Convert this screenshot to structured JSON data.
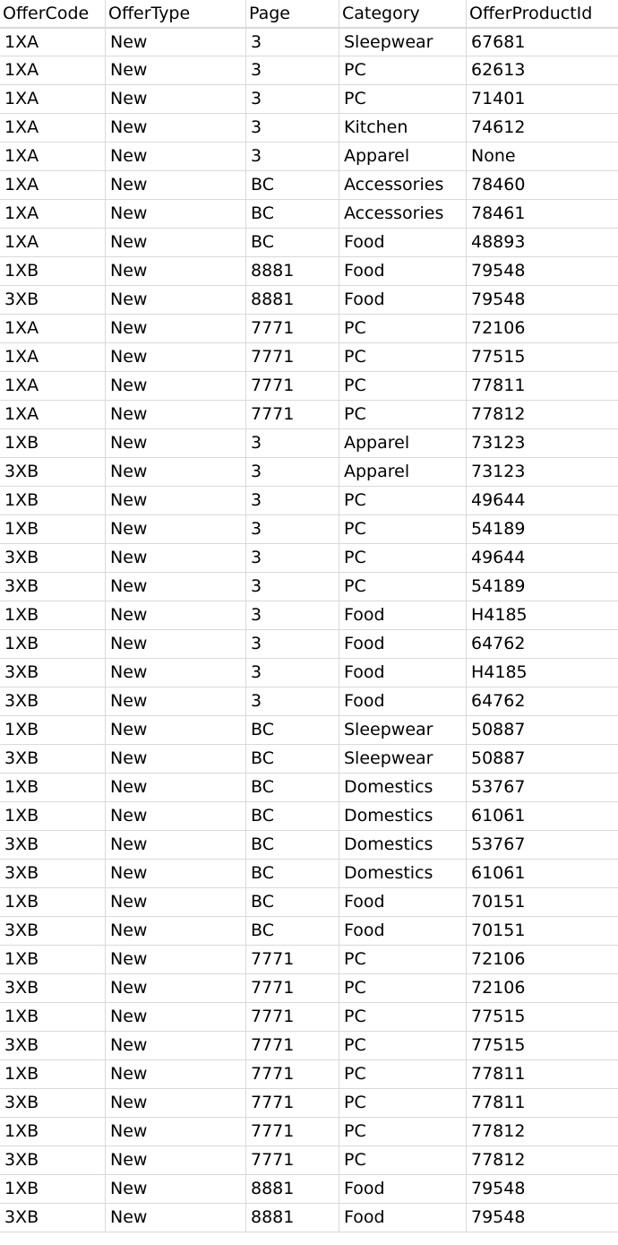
{
  "columns": [
    "OfferCode",
    "OfferType",
    "Page",
    "Category",
    "OfferProductId"
  ],
  "rows": [
    [
      "1XA",
      "New",
      "3",
      "Sleepwear",
      "67681"
    ],
    [
      "1XA",
      "New",
      "3",
      "PC",
      "62613"
    ],
    [
      "1XA",
      "New",
      "3",
      "PC",
      "71401"
    ],
    [
      "1XA",
      "New",
      "3",
      "Kitchen",
      "74612"
    ],
    [
      "1XA",
      "New",
      "3",
      "Apparel",
      "None"
    ],
    [
      "1XA",
      "New",
      "BC",
      "Accessories",
      "78460"
    ],
    [
      "1XA",
      "New",
      "BC",
      "Accessories",
      "78461"
    ],
    [
      "1XA",
      "New",
      "BC",
      "Food",
      "48893"
    ],
    [
      "1XB",
      "New",
      "8881",
      "Food",
      "79548"
    ],
    [
      "3XB",
      "New",
      "8881",
      "Food",
      "79548"
    ],
    [
      "1XA",
      "New",
      "7771",
      "PC",
      "72106"
    ],
    [
      "1XA",
      "New",
      "7771",
      "PC",
      "77515"
    ],
    [
      "1XA",
      "New",
      "7771",
      "PC",
      "77811"
    ],
    [
      "1XA",
      "New",
      "7771",
      "PC",
      "77812"
    ],
    [
      "1XB",
      "New",
      "3",
      "Apparel",
      "73123"
    ],
    [
      "3XB",
      "New",
      "3",
      "Apparel",
      "73123"
    ],
    [
      "1XB",
      "New",
      "3",
      "PC",
      "49644"
    ],
    [
      "1XB",
      "New",
      "3",
      "PC",
      "54189"
    ],
    [
      "3XB",
      "New",
      "3",
      "PC",
      "49644"
    ],
    [
      "3XB",
      "New",
      "3",
      "PC",
      "54189"
    ],
    [
      "1XB",
      "New",
      "3",
      "Food",
      "H4185"
    ],
    [
      "1XB",
      "New",
      "3",
      "Food",
      "64762"
    ],
    [
      "3XB",
      "New",
      "3",
      "Food",
      "H4185"
    ],
    [
      "3XB",
      "New",
      "3",
      "Food",
      "64762"
    ],
    [
      "1XB",
      "New",
      "BC",
      "Sleepwear",
      "50887"
    ],
    [
      "3XB",
      "New",
      "BC",
      "Sleepwear",
      "50887"
    ],
    [
      "1XB",
      "New",
      "BC",
      "Domestics",
      "53767"
    ],
    [
      "1XB",
      "New",
      "BC",
      "Domestics",
      "61061"
    ],
    [
      "3XB",
      "New",
      "BC",
      "Domestics",
      "53767"
    ],
    [
      "3XB",
      "New",
      "BC",
      "Domestics",
      "61061"
    ],
    [
      "1XB",
      "New",
      "BC",
      "Food",
      "70151"
    ],
    [
      "3XB",
      "New",
      "BC",
      "Food",
      "70151"
    ],
    [
      "1XB",
      "New",
      "7771",
      "PC",
      "72106"
    ],
    [
      "3XB",
      "New",
      "7771",
      "PC",
      "72106"
    ],
    [
      "1XB",
      "New",
      "7771",
      "PC",
      "77515"
    ],
    [
      "3XB",
      "New",
      "7771",
      "PC",
      "77515"
    ],
    [
      "1XB",
      "New",
      "7771",
      "PC",
      "77811"
    ],
    [
      "3XB",
      "New",
      "7771",
      "PC",
      "77811"
    ],
    [
      "1XB",
      "New",
      "7771",
      "PC",
      "77812"
    ],
    [
      "3XB",
      "New",
      "7771",
      "PC",
      "77812"
    ],
    [
      "1XB",
      "New",
      "8881",
      "Food",
      "79548"
    ],
    [
      "3XB",
      "New",
      "8881",
      "Food",
      "79548"
    ]
  ]
}
